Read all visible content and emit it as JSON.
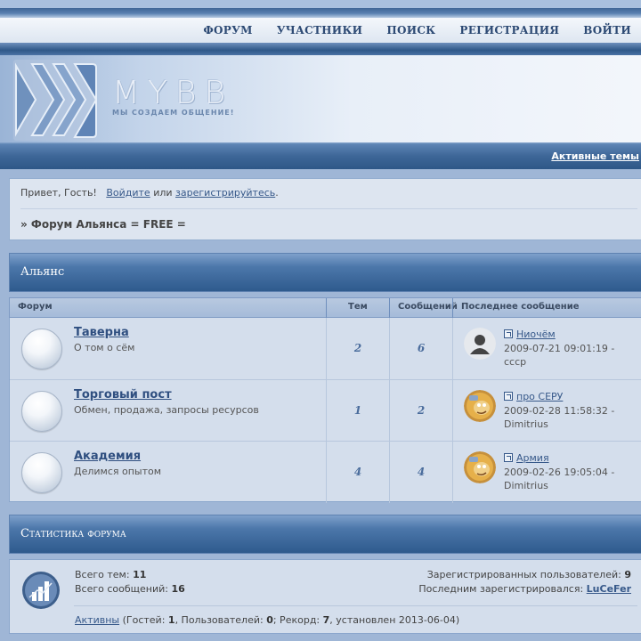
{
  "nav": {
    "items": [
      "ФОРУМ",
      "УЧАСТНИКИ",
      "ПОИСК",
      "РЕГИСТРАЦИЯ",
      "ВОЙТИ"
    ]
  },
  "logo": {
    "text": "MYBB",
    "slogan": "МЫ СОЗДАЕМ ОБЩЕНИЕ!"
  },
  "active_topics_label": "Активные темы",
  "welcome": {
    "greeting": "Привет, Гость!",
    "login_link": "Войдите",
    "or_text": "или",
    "register_link": "зарегистрируйтесь",
    "period": ".",
    "crumbs": "» Форум Альянса = FREE ="
  },
  "category": {
    "title": "Альянс",
    "columns": {
      "forum": "Форум",
      "topics": "Тем",
      "posts": "Сообщений",
      "last_post": "Последнее сообщение"
    },
    "forums": [
      {
        "name": "Таверна",
        "desc": "О том о сём",
        "topics": "2",
        "posts": "6",
        "last_title": "Ниочём",
        "last_date": "2009-07-21 09:01:19 -",
        "last_author": "ссср",
        "avatar": "default-user-icon"
      },
      {
        "name": "Торговый пост",
        "desc": "Обмен, продажа, запросы ресурсов",
        "topics": "1",
        "posts": "2",
        "last_title": "про СЕРУ",
        "last_date": "2009-02-28 11:58:32 -",
        "last_author": "Dimitrius",
        "avatar": "cartoon-avatar"
      },
      {
        "name": "Академия",
        "desc": "Делимся опытом",
        "topics": "4",
        "posts": "4",
        "last_title": "Армия",
        "last_date": "2009-02-26 19:05:04 -",
        "last_author": "Dimitrius",
        "avatar": "cartoon-avatar"
      }
    ]
  },
  "stats": {
    "title": "Статистика форума",
    "total_topics_label": "Всего тем:",
    "total_topics": "11",
    "total_posts_label": "Всего сообщений:",
    "total_posts": "16",
    "registered_label": "Зарегистрированных пользователей:",
    "registered": "9",
    "last_registered_label": "Последним зарегистрировался:",
    "last_registered": "LuCeFer",
    "active_link": "Активны",
    "online_open": " (Гостей: ",
    "guests": "1",
    "users_label": ", Пользователей: ",
    "users": "0",
    "record_label": "; Рекорд: ",
    "record": "7",
    "record_date": ", установлен 2013-06-04)"
  },
  "colors": {
    "accent": "#2e5787",
    "link": "#37598a",
    "panel": "#d4deec"
  }
}
